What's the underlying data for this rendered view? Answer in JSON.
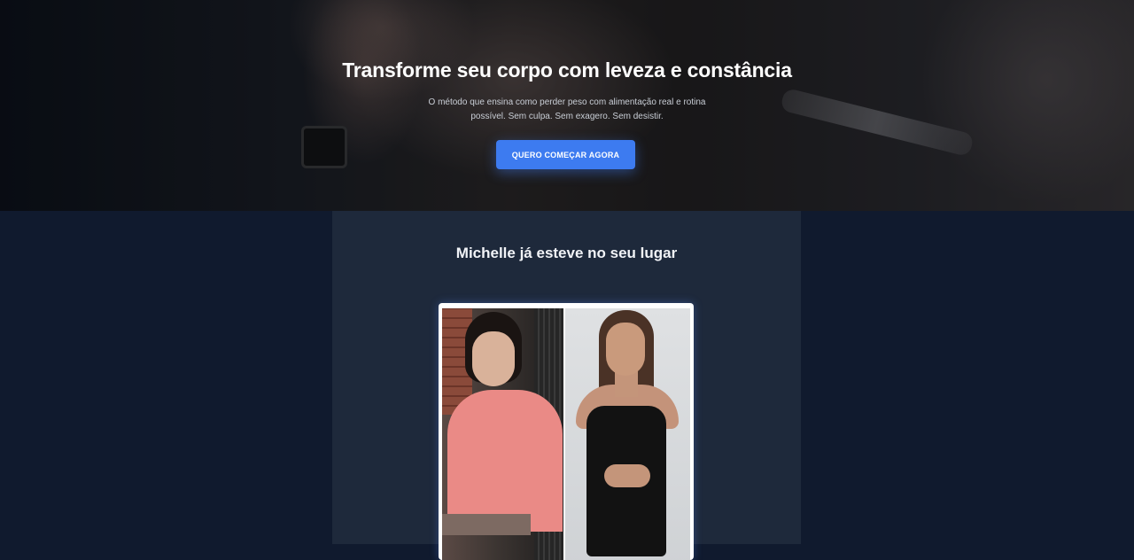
{
  "hero": {
    "title": "Transforme seu corpo com leveza e constância",
    "subtitle": "O método que ensina como perder peso com alimentação real e rotina possível. Sem culpa. Sem exagero. Sem desistir.",
    "cta_label": "QUERO COMEÇAR AGORA"
  },
  "testimonial": {
    "title": "Michelle já esteve no seu lugar"
  },
  "colors": {
    "accent": "#3d7bf0",
    "page_background": "#101a2e",
    "panel_background": "#1e293b"
  }
}
